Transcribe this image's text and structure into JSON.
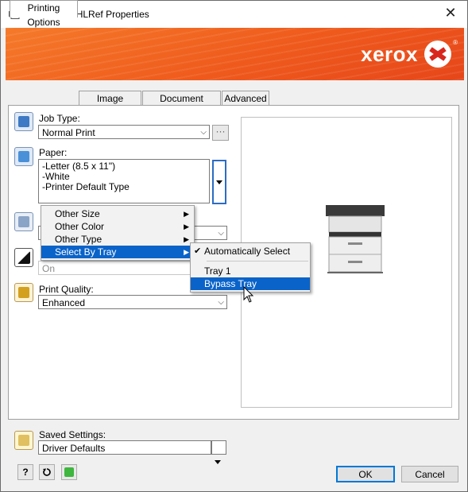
{
  "window": {
    "title": "\\\\hood\\Lab-HLRef Properties",
    "close_glyph": "✕"
  },
  "banner": {
    "brand": "xerox",
    "reg_mark": "®",
    "color": "#ef5a1c"
  },
  "tabs": [
    {
      "label": "Printing Options",
      "active": true
    },
    {
      "label": "Image Options"
    },
    {
      "label": "Document Options"
    },
    {
      "label": "Advanced"
    }
  ],
  "job_type": {
    "label": "Job Type:",
    "value": "Normal Print",
    "more_button": "···"
  },
  "paper": {
    "label": "Paper:",
    "lines": [
      "-Letter (8.5 x 11\")",
      "-White",
      "-Printer Default Type"
    ]
  },
  "disabled_field": {
    "value": "On"
  },
  "print_quality": {
    "label": "Print Quality:",
    "value": "Enhanced"
  },
  "paper_menu": {
    "items": [
      {
        "label": "Other Size"
      },
      {
        "label": "Other Color"
      },
      {
        "label": "Other Type"
      },
      {
        "label": "Select By Tray",
        "highlighted": true
      }
    ]
  },
  "tray_menu": {
    "items": [
      {
        "label": "Automatically Select",
        "checked": true
      },
      {
        "label": "Tray 1"
      },
      {
        "label": "Bypass Tray",
        "highlighted": true
      }
    ]
  },
  "saved_settings": {
    "label": "Saved Settings:",
    "value": "Driver Defaults"
  },
  "footer": {
    "help_glyph": "?",
    "ok_label": "OK",
    "cancel_label": "Cancel"
  },
  "colors": {
    "accent": "#0a63c9",
    "focus": "#0078d7"
  }
}
